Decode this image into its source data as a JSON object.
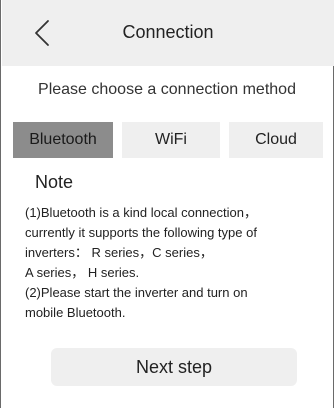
{
  "header": {
    "title": "Connection",
    "back_icon": "chevron-left-icon"
  },
  "prompt": "Please choose a connection method",
  "tabs": [
    {
      "label": "Bluetooth",
      "selected": true
    },
    {
      "label": "WiFi",
      "selected": false
    },
    {
      "label": "Cloud",
      "selected": false
    }
  ],
  "note": {
    "title": "Note",
    "lines": [
      "(1)Bluetooth is a kind local connection，",
      "currently it supports the following type of",
      "inverters： R series，C series，",
      "A series， H series.",
      "(2)Please start the inverter and turn on",
      "mobile Bluetooth."
    ]
  },
  "next_button": "Next step",
  "colors": {
    "header_bg": "#efefef",
    "tab_bg": "#efefef",
    "tab_active_bg": "#8c8c8c",
    "button_bg": "#efefef"
  }
}
